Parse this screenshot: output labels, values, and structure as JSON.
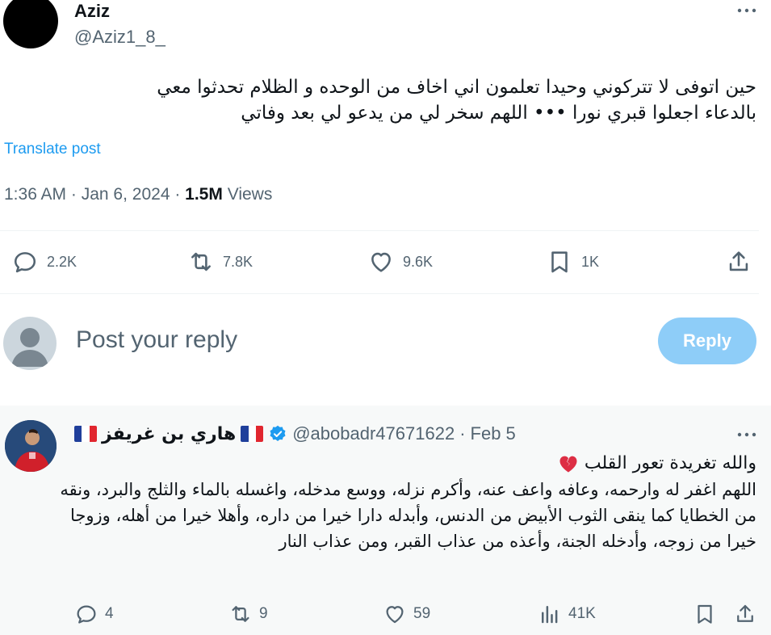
{
  "post": {
    "author_name": "Aziz",
    "author_handle": "@Aziz1_8_",
    "text_line1": "حين اتوفى لا تتركوني وحيدا تعلمون اني اخاف من الوحده و الظلام تحدثوا معي",
    "text_line2": "بالدعاء اجعلوا قبري نورا ••• اللهم سخر لي من يدعو لي بعد وفاتي",
    "translate_label": "Translate post",
    "time": "1:36 AM",
    "date": "Jan 6, 2024",
    "views_count": "1.5M",
    "views_label": "Views",
    "stats": {
      "replies": "2.2K",
      "reposts": "7.8K",
      "likes": "9.6K",
      "bookmarks": "1K"
    }
  },
  "composer": {
    "placeholder": "Post your reply",
    "button_label": "Reply"
  },
  "reply": {
    "name": "هاري بن غريفز",
    "handle": "@abobadr47671622",
    "date": "Feb 5",
    "line1": "والله تغريدة تعور القلب",
    "body": "اللهم اغفر له وارحمه، وعافه واعف عنه، وأكرم نزله، ووسع مدخله، واغسله بالماء والثلج والبرد، ونقه من الخطايا كما ينقى الثوب الأبيض من الدنس، وأبدله دارا خيرا من داره، وأهلا خيرا من أهله، وزوجا خيرا من زوجه، وأدخله الجنة، وأعذه من عذاب القبر، ومن عذاب النار",
    "stats": {
      "replies": "4",
      "reposts": "9",
      "likes": "59",
      "views": "41K"
    }
  },
  "colors": {
    "accent": "#1d9bf0",
    "reply_button": "#8ecdf8",
    "secondary_text": "#536471",
    "reply_background": "#f7f9f9"
  },
  "icons": [
    "more-icon",
    "reply-icon",
    "repost-icon",
    "like-icon",
    "bookmark-icon",
    "share-icon",
    "views-icon",
    "verified-icon",
    "broken-heart-icon",
    "flag-france-icon"
  ]
}
